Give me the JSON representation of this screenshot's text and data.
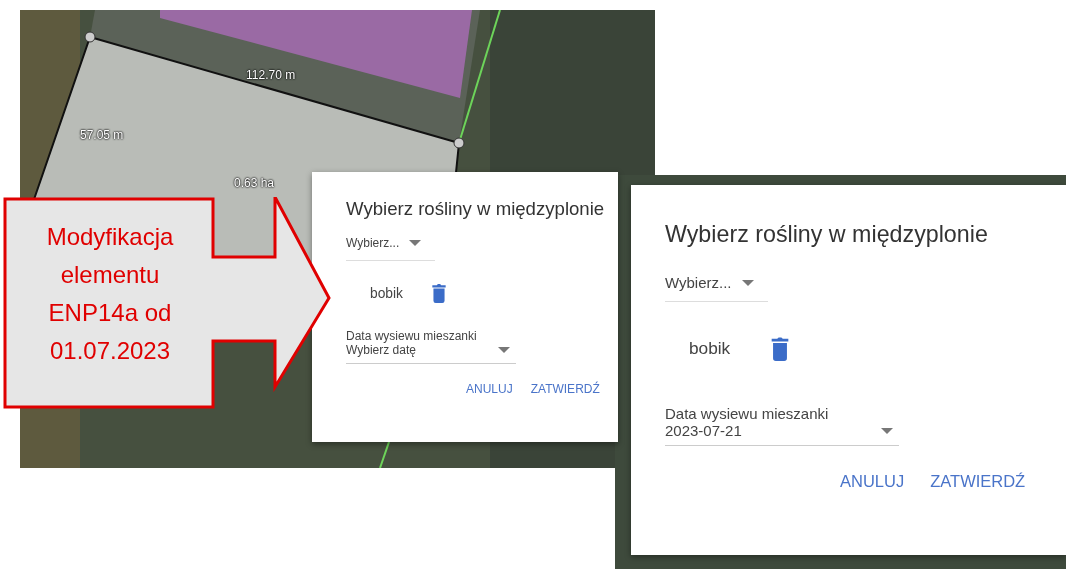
{
  "map": {
    "labels": [
      "112.70 m",
      "57.05 m",
      "0.63 ha"
    ]
  },
  "dialogs": [
    {
      "title": "Wybierz rośliny w międzyplonie",
      "select": {
        "placeholder": "Wybierz..."
      },
      "plants": [
        {
          "name": "bobik"
        }
      ],
      "date_field": {
        "label": "Data wysiewu mieszanki",
        "placeholder": "Wybierz datę"
      },
      "buttons": [
        "ANULUJ",
        "ZATWIERDŹ"
      ]
    },
    {
      "title": "Wybierz rośliny w międzyplonie",
      "select": {
        "placeholder": "Wybierz..."
      },
      "plants": [
        {
          "name": "bobik"
        }
      ],
      "date_field": {
        "label": "Data wysiewu mieszanki",
        "value": "2023-07-21"
      },
      "buttons": [
        "ANULUJ",
        "ZATWIERDŹ"
      ]
    }
  ],
  "callout": {
    "text": "Modyfikacja elementu ENP14a od 01.07.2023"
  }
}
